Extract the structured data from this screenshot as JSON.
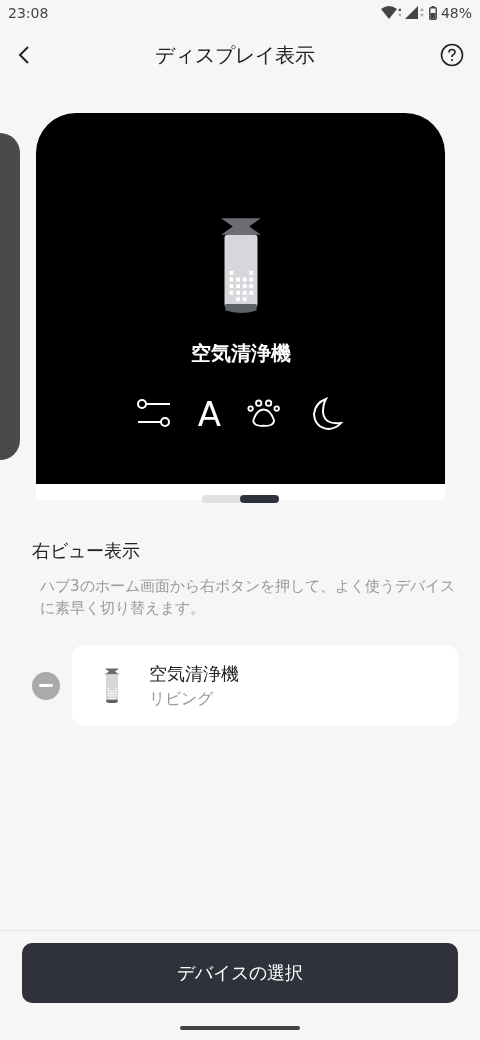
{
  "status_bar": {
    "time": "23:08",
    "battery": "48%"
  },
  "header": {
    "title": "ディスプレイ表示"
  },
  "preview": {
    "device_name": "空気清浄機",
    "mode_letter": "A"
  },
  "pages": [
    {
      "selected": false
    },
    {
      "selected": true
    }
  ],
  "section": {
    "title": "右ビュー表示",
    "description": "ハブ3のホーム画面から右ボタンを押して、よく使うデバイスに素早く切り替えます。"
  },
  "devices": [
    {
      "name": "空気清浄機",
      "room": "リビング"
    }
  ],
  "footer": {
    "button": "デバイスの選択"
  }
}
